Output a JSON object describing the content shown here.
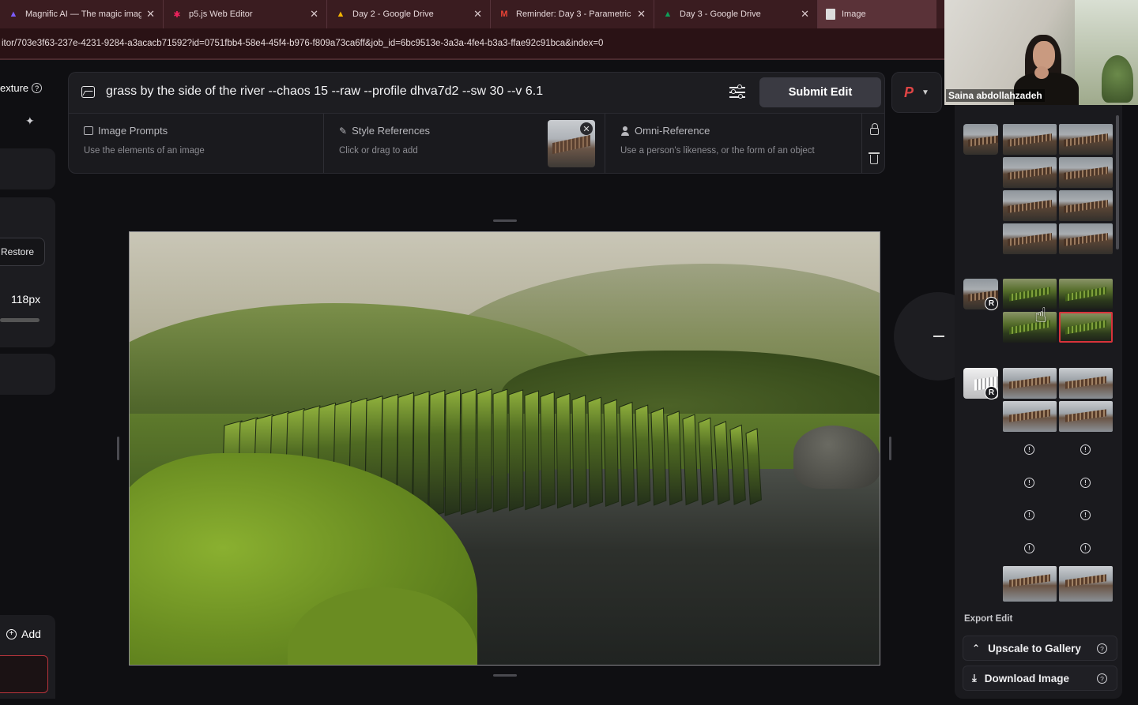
{
  "browser": {
    "tabs": [
      {
        "title": "Magnific AI — The magic imag",
        "icon": "magnific-logo-icon",
        "color": "#7b5cff"
      },
      {
        "title": "p5.js Web Editor",
        "icon": "p5js-star-icon",
        "color": "#ed225d"
      },
      {
        "title": "Day 2 - Google Drive",
        "icon": "google-drive-icon",
        "color": "#4285f4"
      },
      {
        "title": "Reminder: Day 3 - Parametric I",
        "icon": "gmail-icon",
        "color": "#ea4335"
      },
      {
        "title": "Day 3 - Google Drive",
        "icon": "google-drive-icon",
        "color": "#4285f4"
      },
      {
        "title": "Image",
        "icon": "document-icon",
        "color": "#dddddd"
      }
    ],
    "url": "itor/703e3f63-237e-4231-9284-a3acacb71592?id=0751fbb4-58e4-45f4-b976-f809a73ca6ff&job_id=6bc9513e-3a3a-4fe4-b3a3-ffae92c91bca&index=0"
  },
  "webcam": {
    "participant_name": "Saina abdollahzadeh"
  },
  "left_panel": {
    "section_label": "exture",
    "restore_label": "Restore",
    "size_value": "118px",
    "add_label": "Add"
  },
  "prompt": {
    "text": "grass by the side of the river --chaos 15 --raw --profile dhva7d2 --sw 30 --v 6.1",
    "submit_label": "Submit Edit",
    "profile_letter": "P"
  },
  "references": {
    "image_prompts": {
      "title": "Image Prompts",
      "subtitle": "Use the elements of an image"
    },
    "style_references": {
      "title": "Style References",
      "subtitle": "Click or drag to add"
    },
    "omni_reference": {
      "title": "Omni-Reference",
      "subtitle": "Use a person's likeness, or the form of an object"
    }
  },
  "history": {
    "groups": [
      {
        "variant": "bridge",
        "thumbs": 8,
        "badge": ""
      },
      {
        "variant": "grass",
        "thumbs": 4,
        "badge": "R"
      },
      {
        "variant": "water",
        "thumbs": 4,
        "badge": "R"
      }
    ],
    "export_label": "Export Edit",
    "upscale_label": "Upscale to Gallery",
    "download_label": "Download Image",
    "selected_color": "#d8333b"
  }
}
